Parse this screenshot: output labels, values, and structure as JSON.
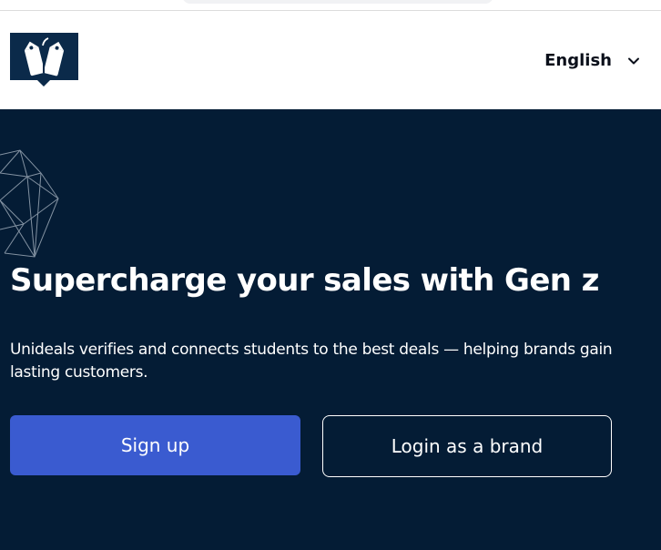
{
  "header": {
    "language_label": "English"
  },
  "hero": {
    "title": "Supercharge your sales with Gen z",
    "subtitle": "Unideals verifies and connects students to the best deals — helping brands gain lasting customers.",
    "signup_label": "Sign up",
    "login_brand_label": "Login as a brand"
  },
  "colors": {
    "hero_background": "#041c35",
    "primary_button": "#3a5bd0",
    "logo_background": "#0b2a4a",
    "text_light": "#ffffff",
    "text_dark": "#0a0f1a"
  },
  "icons": {
    "logo": "price-tags-logo-icon",
    "language_dropdown": "chevron-down-icon",
    "decoration": "wireframe-polyhedron-icon"
  }
}
